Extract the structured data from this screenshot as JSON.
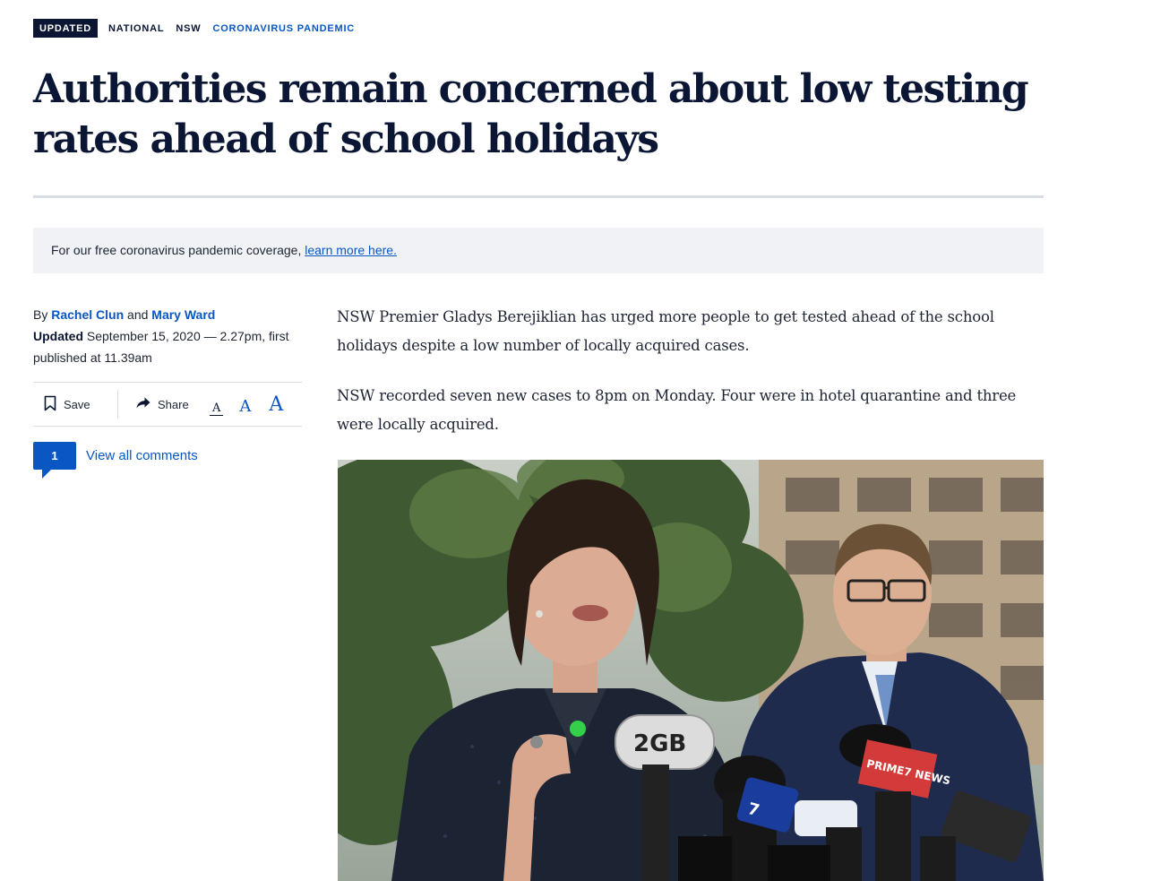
{
  "tags": {
    "badge": "UPDATED",
    "items": [
      "NATIONAL",
      "NSW",
      "CORONAVIRUS PANDEMIC"
    ]
  },
  "headline": "Authorities remain concerned about low testing rates ahead of school holidays",
  "notice": {
    "text": "For our free coronavirus pandemic coverage, ",
    "link": "learn more here."
  },
  "byline": {
    "by": "By ",
    "author1": "Rachel Clun",
    "and": " and ",
    "author2": "Mary Ward",
    "updated_label": "Updated",
    "updated_text": " September 15, 2020 — 2.27pm, first published at 11.39am"
  },
  "toolbar": {
    "save": "Save",
    "share": "Share",
    "size_glyph": "A"
  },
  "comments": {
    "count": "1",
    "label": "View all comments"
  },
  "article": {
    "paragraphs": [
      "NSW Premier Gladys Berejiklian has urged more people to get tested ahead of the school holidays despite a low number of locally acquired cases.",
      "NSW recorded seven new cases to 8pm on Monday. Four were in hotel quarantine and three were locally acquired."
    ]
  },
  "photo": {
    "mic_labels": [
      "2GB",
      "PRIME7 NEWS",
      "7"
    ]
  },
  "colors": {
    "navy": "#0a1633",
    "link_blue": "#0a56c2",
    "rule": "#d9dde3",
    "notice_bg": "#f0f2f5"
  }
}
